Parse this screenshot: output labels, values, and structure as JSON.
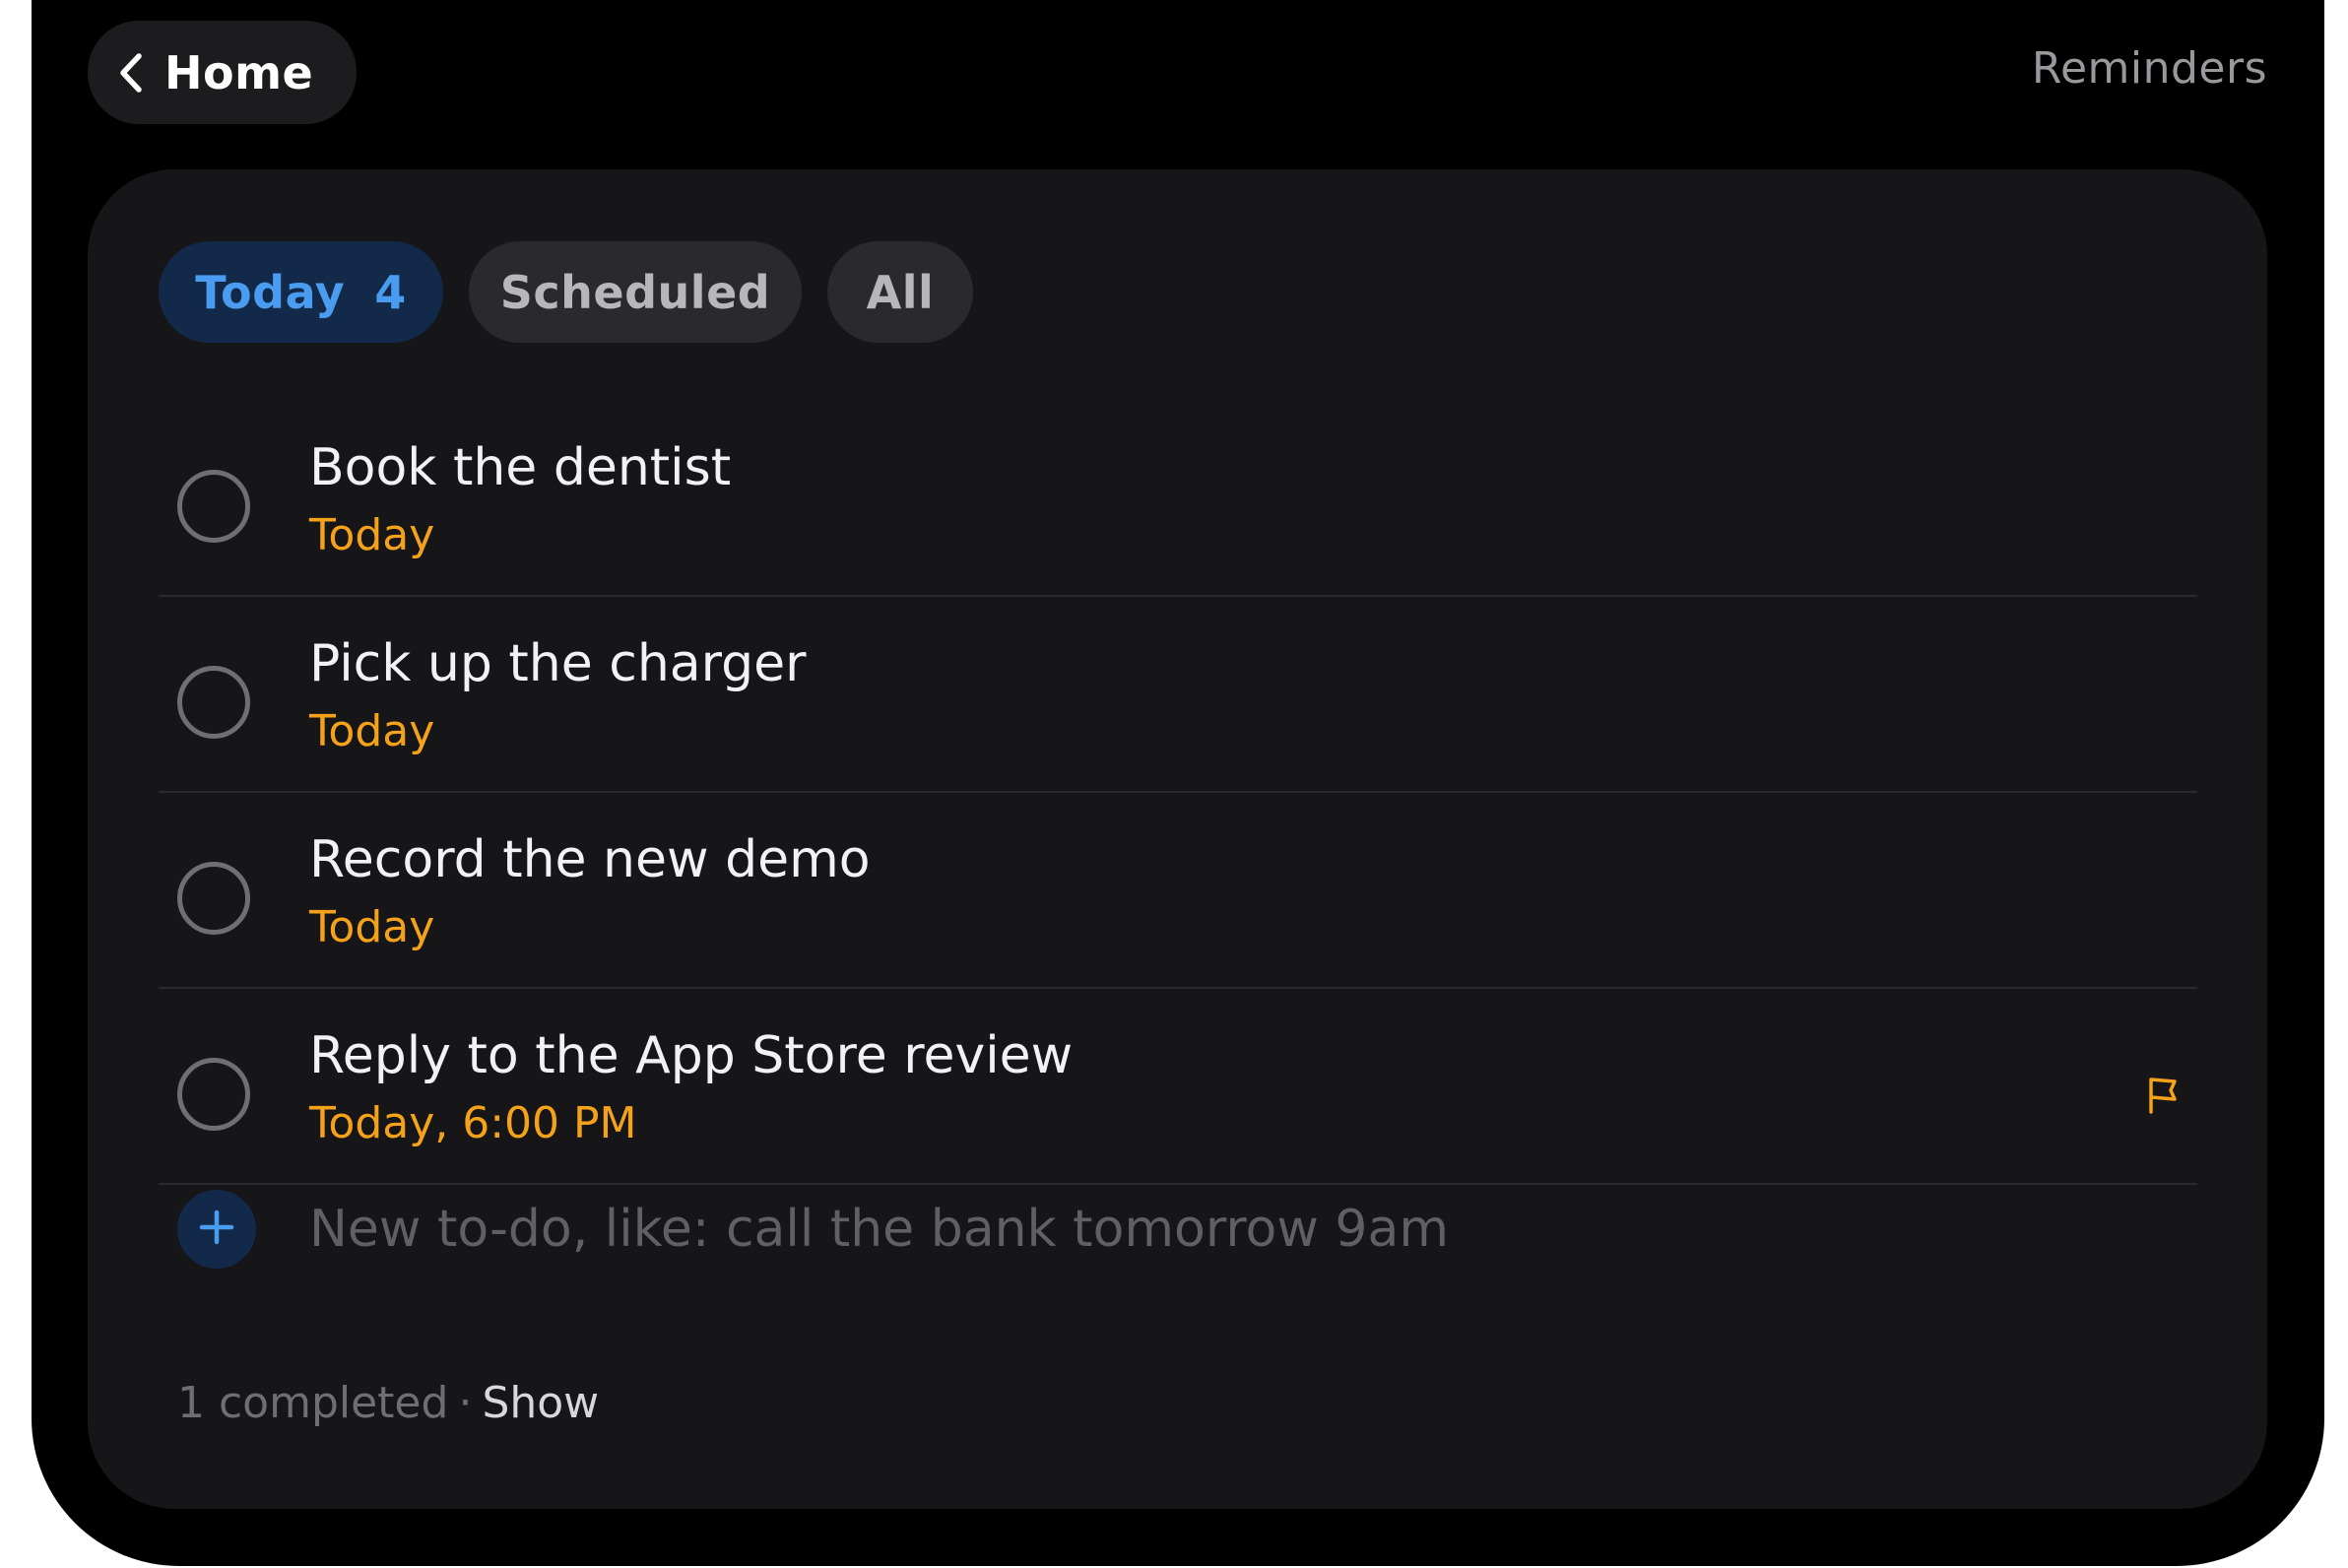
{
  "header": {
    "back_label": "Home",
    "app_title": "Reminders"
  },
  "tabs": [
    {
      "label": "Today",
      "count": "4",
      "active": true
    },
    {
      "label": "Scheduled",
      "count": "",
      "active": false
    },
    {
      "label": "All",
      "count": "",
      "active": false
    }
  ],
  "tasks": [
    {
      "title": "Book the dentist",
      "due": "Today",
      "flagged": false
    },
    {
      "title": "Pick up the charger",
      "due": "Today",
      "flagged": false
    },
    {
      "title": "Record the new demo",
      "due": "Today",
      "flagged": false
    },
    {
      "title": "Reply to the App Store review",
      "due": "Today, 6:00 PM",
      "flagged": true
    }
  ],
  "new_todo": {
    "placeholder": "New to-do, like: call the bank tomorrow 9am",
    "value": ""
  },
  "footer": {
    "completed_text": "1 completed",
    "separator": "·",
    "show_label": "Show"
  },
  "colors": {
    "accent_blue": "#4a9cf0",
    "due_orange": "#f5a21b",
    "background": "#000000",
    "card": "#161618"
  },
  "icons": {
    "back": "chevron-left-icon",
    "add": "plus-icon",
    "flag": "flag-icon",
    "checkbox": "circle-outline-icon"
  }
}
